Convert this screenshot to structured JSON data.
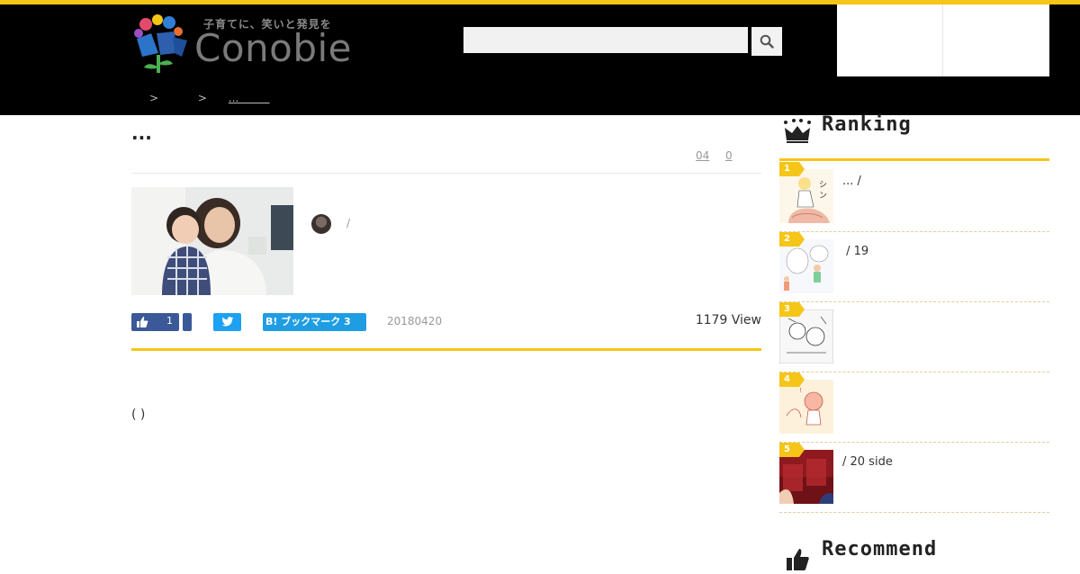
{
  "header": {
    "logo_tagline": "子育てに、笑いと発見を",
    "logo_word": "Conobie",
    "search_placeholder": "",
    "colors": {
      "accent": "#f5c518",
      "background": "#000000"
    }
  },
  "breadcrumb": {
    "sep1": ">",
    "sep2": ">",
    "current": "...         "
  },
  "article": {
    "title": "...",
    "meta_date": "04",
    "meta_count": "0",
    "author_separator": "/",
    "like_count": "1",
    "hatena_label": "B! ブックマーク 3",
    "date": "20180420",
    "views": "1179 View",
    "body_text": "( )"
  },
  "sidebar": {
    "ranking_title": "Ranking",
    "recommend_title": "Recommend",
    "ranking": [
      {
        "rank": "1",
        "text": "... /"
      },
      {
        "rank": "2",
        "text": " / 19"
      },
      {
        "rank": "3",
        "text": ""
      },
      {
        "rank": "4",
        "text": ""
      },
      {
        "rank": "5",
        "text": "/ 20 side"
      }
    ]
  },
  "icons": {
    "search": "search-icon",
    "like": "thumbs-up-icon",
    "twitter": "twitter-bird-icon",
    "crown": "crown-icon",
    "recommend": "thumbs-up-icon"
  }
}
